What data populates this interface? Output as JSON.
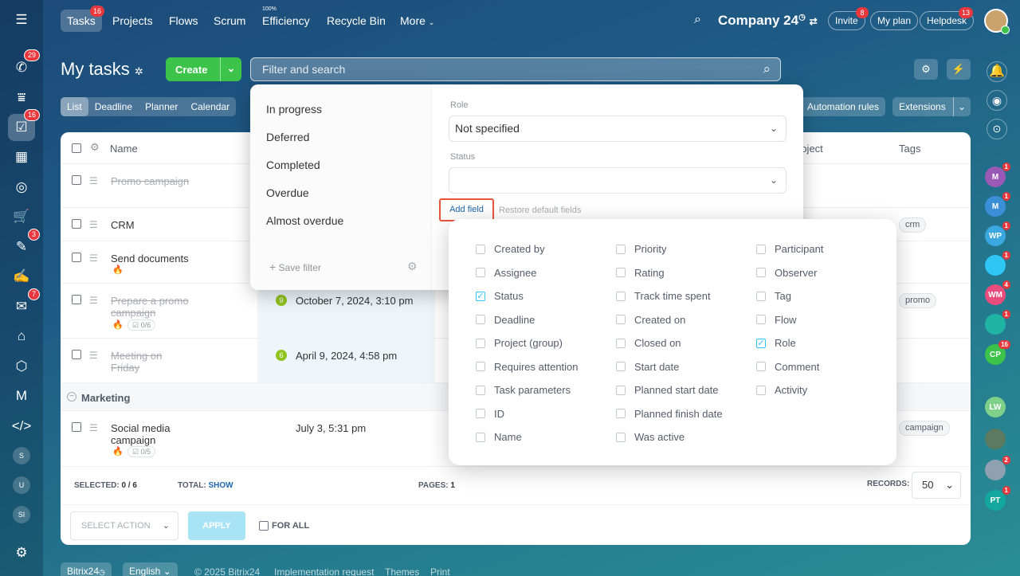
{
  "top_nav": {
    "tasks": "Tasks",
    "tasks_badge": "16",
    "projects": "Projects",
    "flows": "Flows",
    "scrum": "Scrum",
    "efficiency": "Efficiency",
    "efficiency_pct": "100%",
    "recycle": "Recycle Bin",
    "more": "More",
    "company": "Company 24",
    "invite": "Invite",
    "invite_badge": "8",
    "myplan": "My plan",
    "helpdesk": "Helpdesk",
    "helpdesk_badge": "13"
  },
  "left_sidebar": {
    "badges": [
      "29",
      "16",
      "3",
      "7"
    ],
    "avatars": [
      "S",
      "U",
      "SI"
    ]
  },
  "header": {
    "title": "My tasks",
    "create": "Create",
    "search_placeholder": "Filter and search",
    "automation": "Automation rules",
    "extensions": "Extensions"
  },
  "view_tabs": [
    "List",
    "Deadline",
    "Planner",
    "Calendar"
  ],
  "grid": {
    "col_name": "Name",
    "col_project": "roject",
    "col_tags": "Tags",
    "rows": [
      {
        "name": "Promo campaign",
        "done": true
      },
      {
        "name": "CRM",
        "done": false,
        "tag": "crm"
      },
      {
        "name": "Send documents",
        "done": false
      },
      {
        "name": "Prepare a promo campaign",
        "done": true,
        "checklist": "0/6",
        "deadline": "October 7, 2024, 3:10 pm",
        "count": "9",
        "tag": "promo"
      },
      {
        "name": "Meeting on Friday",
        "done": true,
        "deadline": "April 9, 2024, 4:58 pm",
        "count": "6"
      },
      {
        "name": "Social media campaign",
        "done": false,
        "checklist": "0/5",
        "deadline": "July 3, 5:31 pm",
        "tag": "campaign"
      }
    ],
    "group": "Marketing",
    "selected_label": "SELECTED:",
    "selected": "0 / 6",
    "total_label": "TOTAL:",
    "total": "SHOW",
    "pages_label": "PAGES:",
    "pages": "1",
    "records_label": "RECORDS:",
    "records": "50",
    "select_action": "SELECT ACTION",
    "apply": "APPLY",
    "for_all": "FOR ALL"
  },
  "filter": {
    "presets": [
      "In progress",
      "Deferred",
      "Completed",
      "Overdue",
      "Almost overdue"
    ],
    "save_filter": "Save filter",
    "role_label": "Role",
    "role_value": "Not specified",
    "status_label": "Status",
    "add_field": "Add field",
    "restore": "Restore default fields"
  },
  "fields": {
    "col1": [
      {
        "label": "Created by",
        "on": false
      },
      {
        "label": "Assignee",
        "on": false
      },
      {
        "label": "Status",
        "on": true
      },
      {
        "label": "Deadline",
        "on": false
      },
      {
        "label": "Project (group)",
        "on": false
      },
      {
        "label": "Requires attention",
        "on": false
      },
      {
        "label": "Task parameters",
        "on": false
      },
      {
        "label": "ID",
        "on": false
      },
      {
        "label": "Name",
        "on": false
      }
    ],
    "col2": [
      {
        "label": "Priority",
        "on": false
      },
      {
        "label": "Rating",
        "on": false
      },
      {
        "label": "Track time spent",
        "on": false
      },
      {
        "label": "Created on",
        "on": false
      },
      {
        "label": "Closed on",
        "on": false
      },
      {
        "label": "Start date",
        "on": false
      },
      {
        "label": "Planned start date",
        "on": false
      },
      {
        "label": "Planned finish date",
        "on": false
      },
      {
        "label": "Was active",
        "on": false
      }
    ],
    "col3": [
      {
        "label": "Participant",
        "on": false
      },
      {
        "label": "Observer",
        "on": false
      },
      {
        "label": "Tag",
        "on": false
      },
      {
        "label": "Flow",
        "on": false
      },
      {
        "label": "Role",
        "on": true
      },
      {
        "label": "Comment",
        "on": false
      },
      {
        "label": "Activity",
        "on": false
      }
    ]
  },
  "right_sidebar": [
    {
      "t": "M",
      "c": "#9b59b6",
      "b": "1"
    },
    {
      "t": "M",
      "c": "#3b8fd6",
      "b": "1"
    },
    {
      "t": "WP",
      "c": "#3ba7e0",
      "b": "1"
    },
    {
      "t": "",
      "c": "#2fc6f6",
      "b": "1"
    },
    {
      "t": "WM",
      "c": "#e84c7d",
      "b": "4"
    },
    {
      "t": "",
      "c": "#1fb5a5",
      "b": "1"
    },
    {
      "t": "CP",
      "c": "#3bc34a",
      "b": "16"
    },
    {
      "t": "LW",
      "c": "#7fd08a",
      "b": ""
    },
    {
      "t": "",
      "c": "#5c7a60",
      "b": ""
    },
    {
      "t": "",
      "c": "#8fa0b0",
      "b": "2"
    },
    {
      "t": "PT",
      "c": "#12a89d",
      "b": "1"
    }
  ],
  "footer": {
    "brand": "Bitrix24",
    "lang": "English",
    "copyright": "© 2025 Bitrix24",
    "impl": "Implementation request",
    "themes": "Themes",
    "print": "Print"
  },
  "colors": {
    "accent": "#2fc6f6",
    "create": "#3bc34a",
    "badge": "#e8373d",
    "highlight": "#e9553c"
  }
}
